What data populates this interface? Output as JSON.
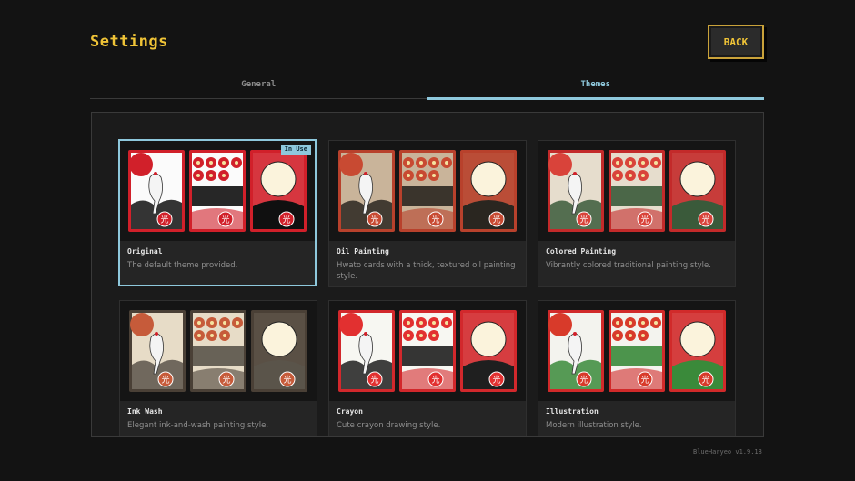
{
  "header": {
    "title": "Settings",
    "back_label": "BACK"
  },
  "tabs": [
    {
      "label": "General",
      "active": false
    },
    {
      "label": "Themes",
      "active": true
    }
  ],
  "themes": [
    {
      "name": "Original",
      "description": "The default theme provided.",
      "badge": "In Use",
      "selected": true,
      "palette": {
        "bg": "#fbfbfb",
        "frame": "#d1202a",
        "accent": "#d1202a",
        "ground": "#101010"
      }
    },
    {
      "name": "Oil Painting",
      "description": "Hwato cards with a thick, textured oil painting style.",
      "selected": false,
      "palette": {
        "bg": "#c9b49a",
        "frame": "#b8412c",
        "accent": "#c84a32",
        "ground": "#2a2620"
      }
    },
    {
      "name": "Colored Painting",
      "description": "Vibrantly colored traditional painting style.",
      "selected": false,
      "palette": {
        "bg": "#e6ddcd",
        "frame": "#c32a2a",
        "accent": "#d9433a",
        "ground": "#3a5a3a"
      }
    },
    {
      "name": "Ink Wash",
      "description": "Elegant ink-and-wash painting style.",
      "selected": false,
      "palette": {
        "bg": "#e7dcc7",
        "frame": "#4a4036",
        "accent": "#c65b3a",
        "ground": "#5a544a"
      }
    },
    {
      "name": "Crayon",
      "description": "Cute crayon drawing style.",
      "selected": false,
      "palette": {
        "bg": "#f7f7f2",
        "frame": "#d2282c",
        "accent": "#e23030",
        "ground": "#1f1f1f"
      }
    },
    {
      "name": "Illustration",
      "description": "Modern illustration style.",
      "selected": false,
      "palette": {
        "bg": "#f3f3ee",
        "frame": "#d12a2a",
        "accent": "#d83a2a",
        "ground": "#3a8a3a"
      }
    }
  ],
  "card_glyph": "光",
  "version": "BlueHaryeo v1.9.18"
}
